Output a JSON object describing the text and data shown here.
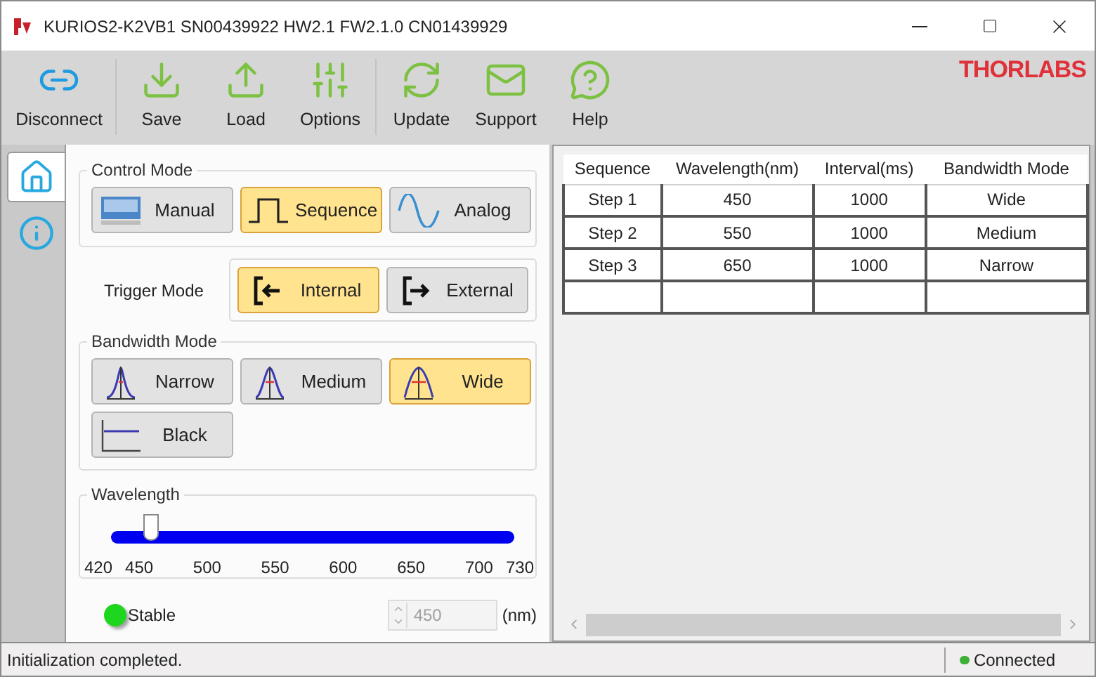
{
  "window": {
    "title": "KURIOS2-K2VB1 SN00439922 HW2.1 FW2.1.0 CN01439929"
  },
  "toolbar": [
    {
      "label": "Disconnect",
      "kind": "link"
    },
    {
      "label": "Save",
      "kind": "save"
    },
    {
      "label": "Load",
      "kind": "load"
    },
    {
      "label": "Options",
      "kind": "options"
    },
    {
      "label": "Update",
      "kind": "update"
    },
    {
      "label": "Support",
      "kind": "support"
    },
    {
      "label": "Help",
      "kind": "help"
    }
  ],
  "logo": "THORLABS",
  "side_tabs": [
    {
      "kind": "home",
      "selected": true
    },
    {
      "kind": "info",
      "selected": false
    }
  ],
  "control_mode": {
    "title": "Control Mode",
    "options": [
      {
        "label": "Manual",
        "kind": "manual",
        "selected": false
      },
      {
        "label": "Sequence",
        "kind": "sequence",
        "selected": true
      },
      {
        "label": "Analog",
        "kind": "analog",
        "selected": false
      }
    ]
  },
  "trigger_mode": {
    "label": "Trigger Mode",
    "options": [
      {
        "label": "Internal",
        "kind": "internal",
        "selected": true
      },
      {
        "label": "External",
        "kind": "external",
        "selected": false
      }
    ]
  },
  "bandwidth_mode": {
    "title": "Bandwidth Mode",
    "options": [
      {
        "label": "Narrow",
        "kind": "narrow",
        "selected": false
      },
      {
        "label": "Medium",
        "kind": "medium",
        "selected": false
      },
      {
        "label": "Wide",
        "kind": "wide",
        "selected": true
      },
      {
        "label": "Black",
        "kind": "black",
        "selected": false
      }
    ]
  },
  "wavelength": {
    "title": "Wavelength",
    "level": 0.097,
    "ticks": [
      "420",
      "450",
      "500",
      "550",
      "600",
      "650",
      "700",
      "730"
    ]
  },
  "status_indicator": {
    "label": "Stable",
    "color": "#1ed61e"
  },
  "spinner": {
    "value": "450",
    "unit": "(nm)",
    "disabled": true
  },
  "table": {
    "columns": [
      "Sequence",
      "Wavelength(nm)",
      "Interval(ms)",
      "Bandwidth Mode"
    ],
    "rows": [
      [
        "Step 1",
        "450",
        "1000",
        "Wide"
      ],
      [
        "Step 2",
        "550",
        "1000",
        "Medium"
      ],
      [
        "Step 3",
        "650",
        "1000",
        "Narrow"
      ]
    ]
  },
  "status_bar": {
    "message": "Initialization completed.",
    "connection": {
      "label": "Connected",
      "color": "#3cb034"
    }
  }
}
